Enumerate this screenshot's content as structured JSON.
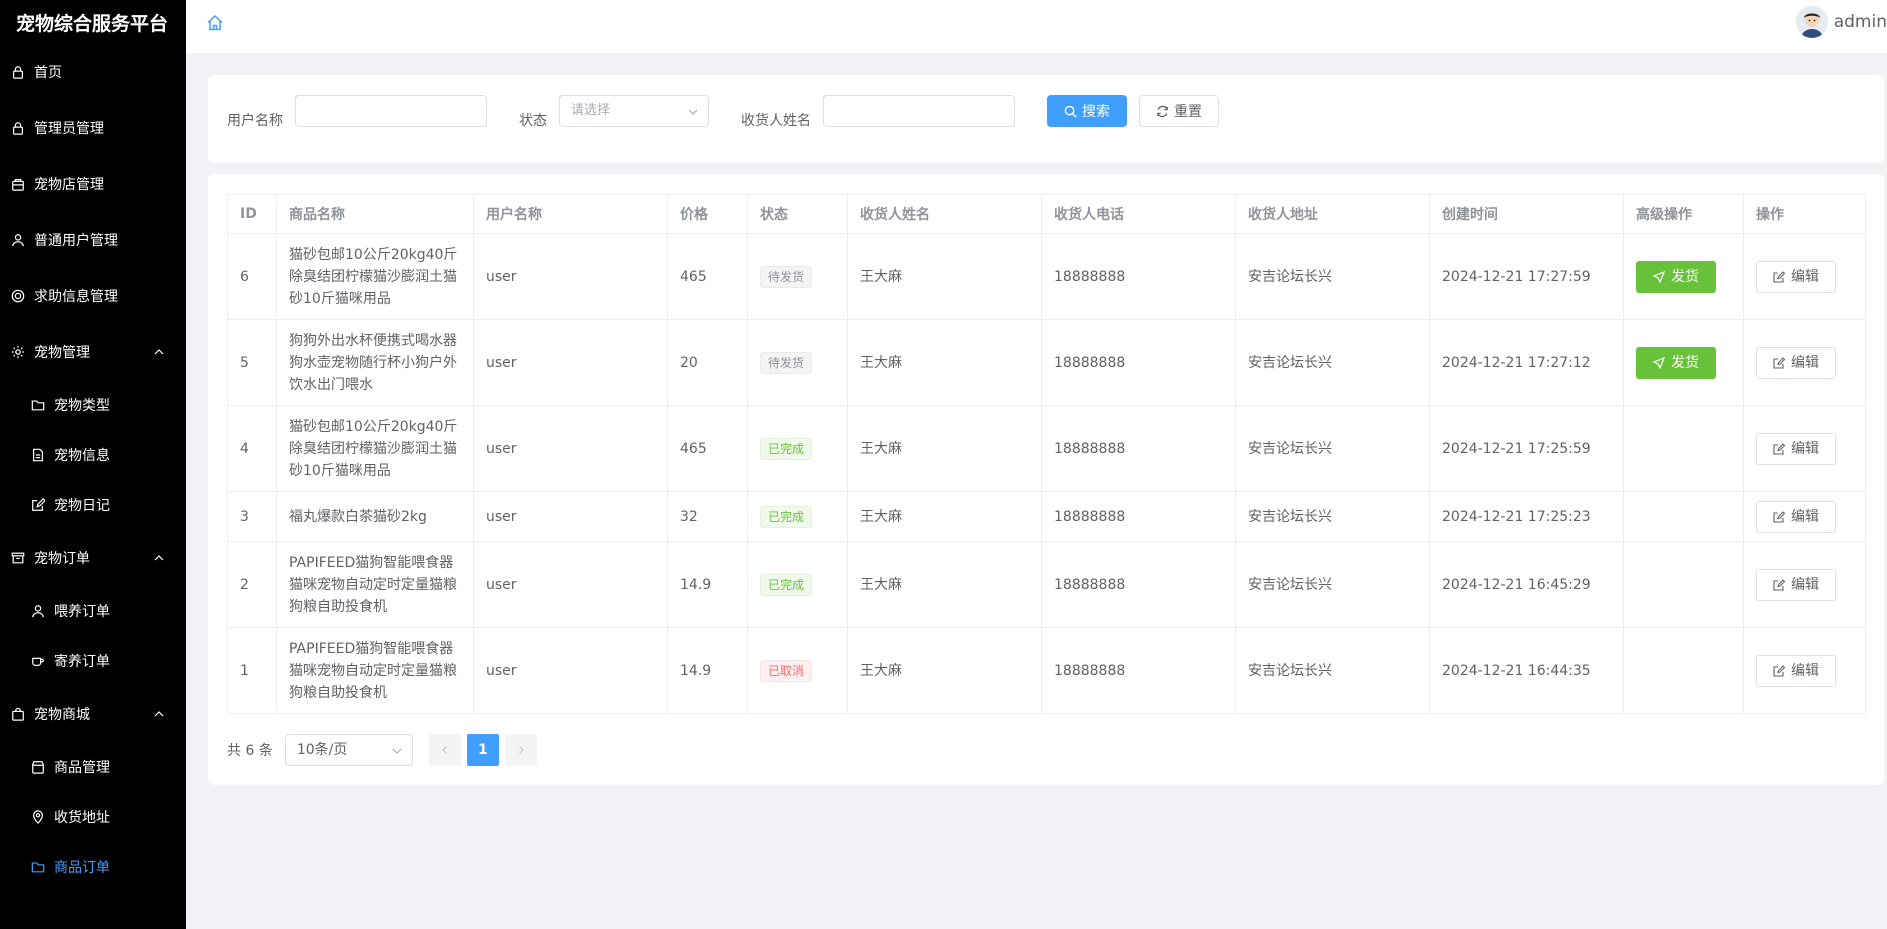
{
  "sidebar": {
    "title": "宠物综合服务平台",
    "items": [
      {
        "label": "首页"
      },
      {
        "label": "管理员管理"
      },
      {
        "label": "宠物店管理"
      },
      {
        "label": "普通用户管理"
      },
      {
        "label": "求助信息管理"
      },
      {
        "label": "宠物管理"
      },
      {
        "label": "宠物类型"
      },
      {
        "label": "宠物信息"
      },
      {
        "label": "宠物日记"
      },
      {
        "label": "宠物订单"
      },
      {
        "label": "喂养订单"
      },
      {
        "label": "寄养订单"
      },
      {
        "label": "宠物商城"
      },
      {
        "label": "商品管理"
      },
      {
        "label": "收货地址"
      },
      {
        "label": "商品订单"
      }
    ]
  },
  "header": {
    "username": "admin"
  },
  "search": {
    "username_label": "用户名称",
    "username_value": "",
    "status_label": "状态",
    "status_placeholder": "请选择",
    "receiver_label": "收货人姓名",
    "receiver_value": "",
    "search_btn": "搜索",
    "reset_btn": "重置"
  },
  "table": {
    "headers": [
      "ID",
      "商品名称",
      "用户名称",
      "价格",
      "状态",
      "收货人姓名",
      "收货人电话",
      "收货人地址",
      "创建时间",
      "高级操作",
      "操作"
    ],
    "ship_label": "发货",
    "edit_label": "编辑",
    "rows": [
      {
        "id": "6",
        "product": "猫砂包邮10公斤20kg40斤除臭结团柠檬猫沙膨润土猫砂10斤猫咪用品",
        "user": "user",
        "price": "465",
        "status": "待发货",
        "receiver": "王大麻",
        "phone": "18888888",
        "address": "安吉论坛长兴",
        "created": "2024-12-21 17:27:59"
      },
      {
        "id": "5",
        "product": "狗狗外出水杯便携式喝水器狗水壶宠物随行杯小狗户外饮水出门喂水",
        "user": "user",
        "price": "20",
        "status": "待发货",
        "receiver": "王大麻",
        "phone": "18888888",
        "address": "安吉论坛长兴",
        "created": "2024-12-21 17:27:12"
      },
      {
        "id": "4",
        "product": "猫砂包邮10公斤20kg40斤除臭结团柠檬猫沙膨润土猫砂10斤猫咪用品",
        "user": "user",
        "price": "465",
        "status": "已完成",
        "receiver": "王大麻",
        "phone": "18888888",
        "address": "安吉论坛长兴",
        "created": "2024-12-21 17:25:59"
      },
      {
        "id": "3",
        "product": "福丸爆款白茶猫砂2kg",
        "user": "user",
        "price": "32",
        "status": "已完成",
        "receiver": "王大麻",
        "phone": "18888888",
        "address": "安吉论坛长兴",
        "created": "2024-12-21 17:25:23"
      },
      {
        "id": "2",
        "product": "PAPIFEED猫狗智能喂食器猫咪宠物自动定时定量猫粮狗粮自助投食机",
        "user": "user",
        "price": "14.9",
        "status": "已完成",
        "receiver": "王大麻",
        "phone": "18888888",
        "address": "安吉论坛长兴",
        "created": "2024-12-21 16:45:29"
      },
      {
        "id": "1",
        "product": "PAPIFEED猫狗智能喂食器猫咪宠物自动定时定量猫粮狗粮自助投食机",
        "user": "user",
        "price": "14.9",
        "status": "已取消",
        "receiver": "王大麻",
        "phone": "18888888",
        "address": "安吉论坛长兴",
        "created": "2024-12-21 16:44:35"
      }
    ]
  },
  "pagination": {
    "total": "共 6 条",
    "page_size": "10条/页",
    "current": "1"
  },
  "colors": {
    "primary": "#409eff",
    "success": "#67c23a",
    "danger": "#f56c6c",
    "sidebar": "#000000"
  }
}
